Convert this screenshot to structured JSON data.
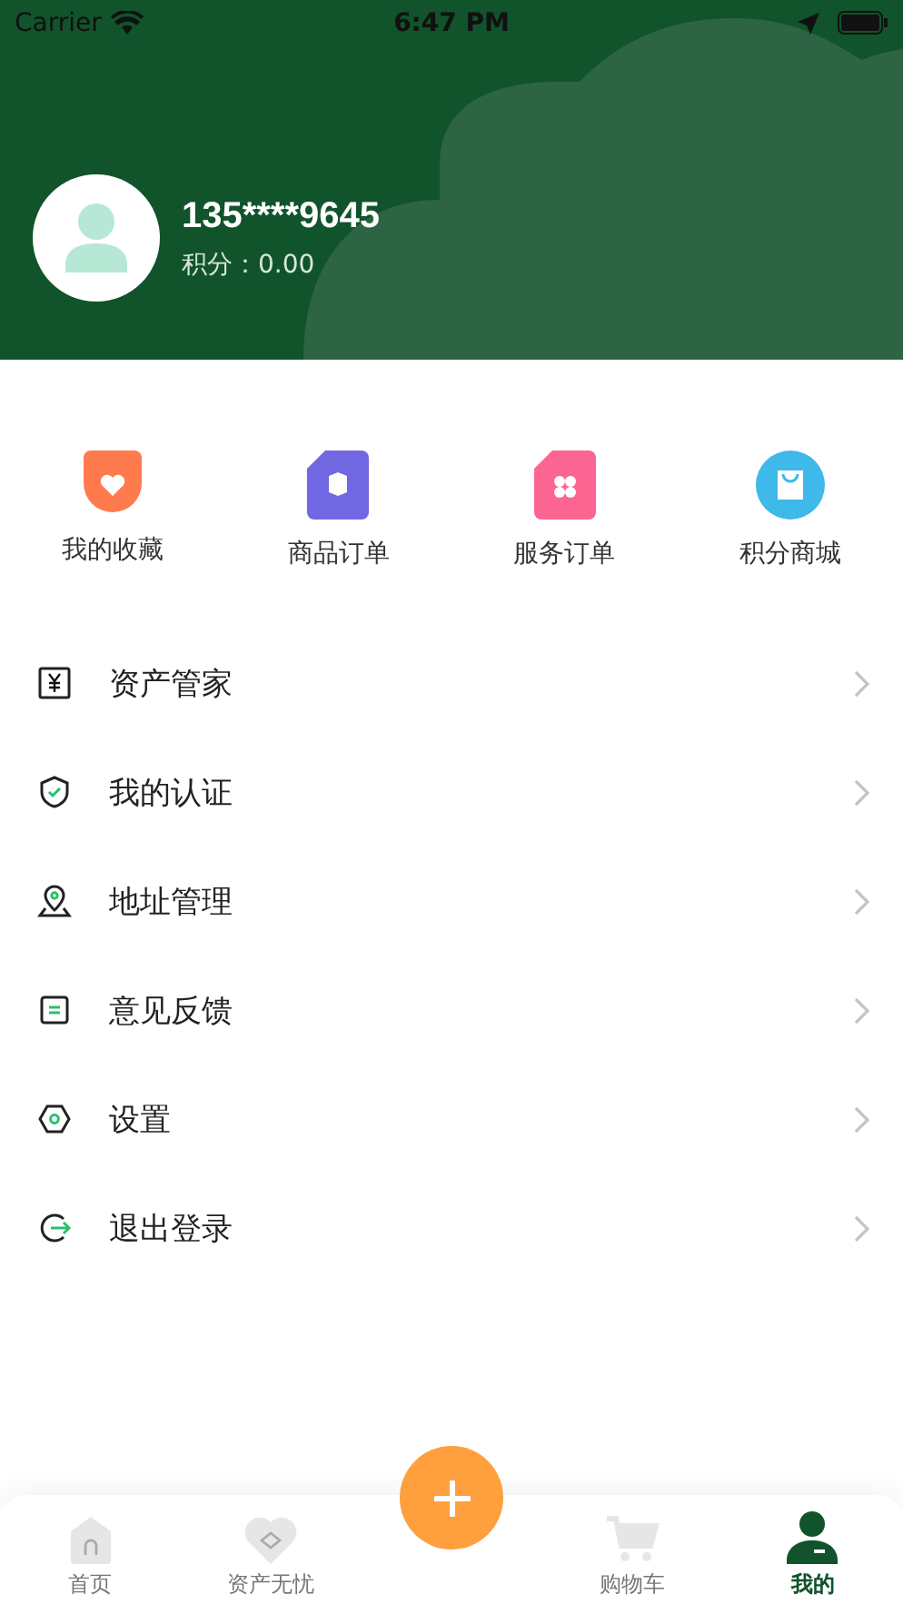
{
  "status_bar": {
    "carrier": "Carrier",
    "time": "6:47 PM"
  },
  "profile": {
    "phone": "135****9645",
    "points_label": "积分：",
    "points": "0.00"
  },
  "shortcuts": [
    {
      "label": "我的收藏",
      "kind": "heart",
      "color": "#ff7a4d"
    },
    {
      "label": "商品订单",
      "kind": "box",
      "color": "#7167e3"
    },
    {
      "label": "服务订单",
      "kind": "clover",
      "color": "#fb6592"
    },
    {
      "label": "积分商城",
      "kind": "bag",
      "color": "#3fb8ea"
    }
  ],
  "menu": [
    {
      "label": "资产管家",
      "kind": "yen"
    },
    {
      "label": "我的认证",
      "kind": "shield"
    },
    {
      "label": "地址管理",
      "kind": "pin"
    },
    {
      "label": "意见反馈",
      "kind": "note"
    },
    {
      "label": "设置",
      "kind": "gear"
    },
    {
      "label": "退出登录",
      "kind": "logout"
    }
  ],
  "tabs": [
    {
      "label": "首页",
      "kind": "home",
      "selected": false
    },
    {
      "label": "资产无忧",
      "kind": "heart",
      "selected": false
    },
    {
      "label": "购物车",
      "kind": "cart",
      "selected": false
    },
    {
      "label": "我的",
      "kind": "user",
      "selected": true
    }
  ]
}
